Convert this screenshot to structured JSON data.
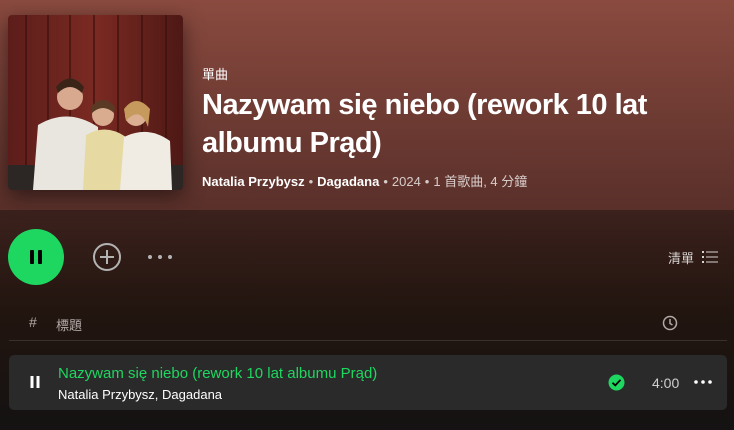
{
  "colors": {
    "accent_green": "#1ed760",
    "hero_bg": "#7a4238",
    "row_bg": "#2a2a2a"
  },
  "header": {
    "type_label": "單曲",
    "title": "Nazywam się niebo (rework 10 lat albumu Prąd)",
    "artist_1": "Natalia Przybysz",
    "artist_2": "Dagadana",
    "year": "2024",
    "summary": "1 首歌曲, 4 分鐘",
    "separator": "•"
  },
  "controls": {
    "play_state_icon": "pause-icon",
    "add_icon": "add-circle-icon",
    "more_icon": "more-horizontal-icon",
    "list_view_label": "清單",
    "list_view_icon": "list-icon"
  },
  "tracklist": {
    "col_number": "#",
    "col_title": "標題",
    "col_duration_icon": "clock-icon",
    "tracks": [
      {
        "title": "Nazywam się niebo (rework 10 lat albumu Prąd)",
        "artists": "Natalia Przybysz, Dagadana",
        "duration": "4:00",
        "saved": true,
        "playing": true
      }
    ]
  }
}
